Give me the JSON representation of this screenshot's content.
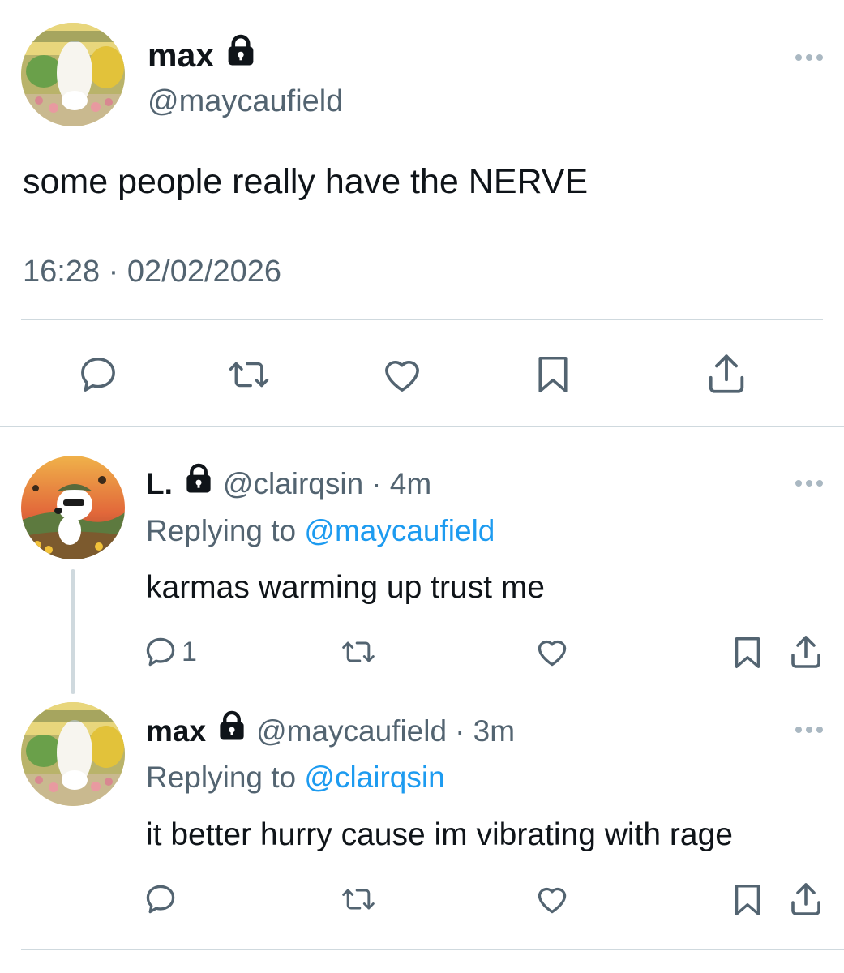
{
  "main_tweet": {
    "name": "max",
    "handle": "@maycaufield",
    "text": "some people really have the NERVE",
    "timestamp": "16:28 · 02/02/2026"
  },
  "replies": [
    {
      "name": "L.",
      "handle": "@clairqsin",
      "time": "· 4m",
      "replying_label": "Replying to",
      "replying_to": "@maycaufield",
      "text": "karmas warming up trust me",
      "reply_count": "1"
    },
    {
      "name": "max",
      "handle": "@maycaufield",
      "time": "· 3m",
      "replying_label": "Replying to",
      "replying_to": "@clairqsin",
      "text": "it better hurry cause im vibrating with rage",
      "reply_count": ""
    }
  ],
  "icons": {
    "lock": "lock-icon",
    "reply": "reply-icon",
    "retweet": "retweet-icon",
    "like": "like-icon",
    "bookmark": "bookmark-icon",
    "share": "share-icon",
    "more": "more-icon"
  },
  "colors": {
    "text": "#0f1419",
    "secondary": "#536471",
    "link": "#1d9bf0",
    "divider": "#cfd9de",
    "icon": "#536471"
  }
}
